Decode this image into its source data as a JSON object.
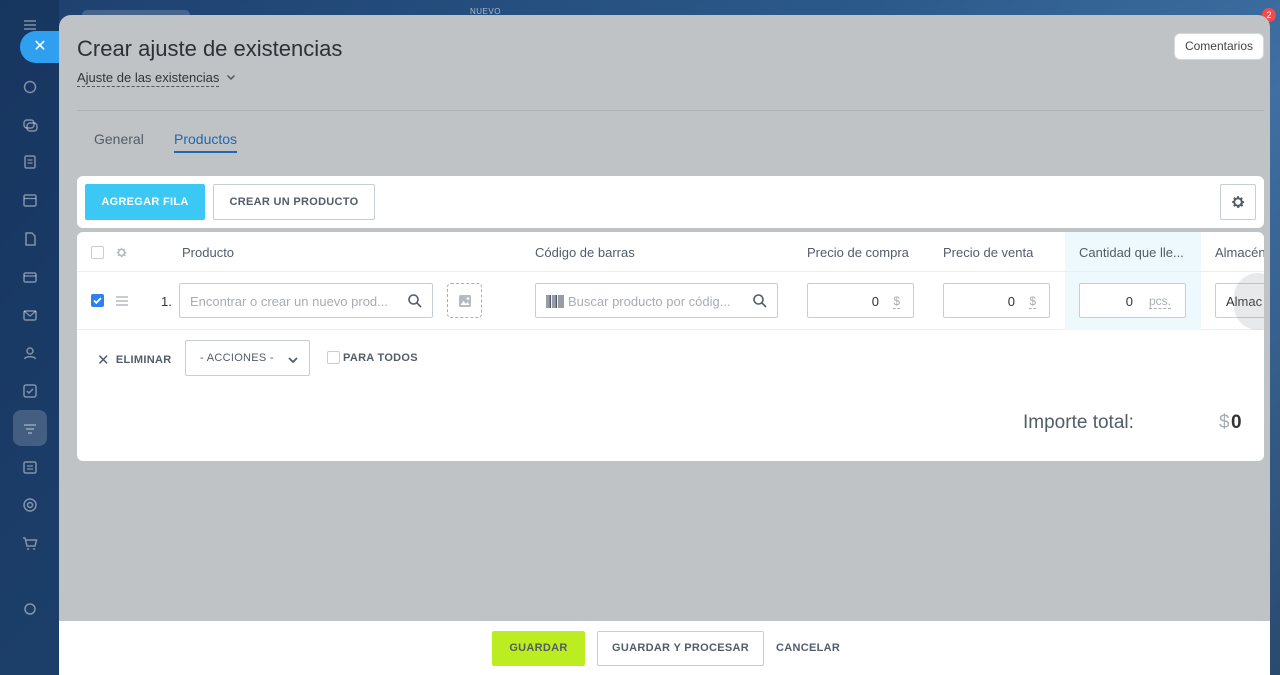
{
  "background": {
    "top_label": "NUEVO",
    "notification_count": "2"
  },
  "slider": {
    "title": "Crear ajuste de existencias",
    "doc_type": "Ajuste de las existencias",
    "comments_label": "Comentarios",
    "tabs": [
      {
        "label": "General",
        "active": false
      },
      {
        "label": "Productos",
        "active": true
      }
    ]
  },
  "toolbar": {
    "add_row_label": "AGREGAR FILA",
    "create_product_label": "CREAR UN PRODUCTO"
  },
  "grid": {
    "columns": [
      "Producto",
      "Código de barras",
      "Precio de compra",
      "Precio de venta",
      "Cantidad que lle...",
      "Almacén"
    ],
    "rows": [
      {
        "index": "1.",
        "checked": true,
        "product_placeholder": "Encontrar o crear un nuevo prod...",
        "barcode_placeholder": "Buscar producto por códig...",
        "purchase_price": "0",
        "purchase_currency": "$",
        "sale_price": "0",
        "sale_currency": "$",
        "quantity": "0",
        "unit": "pcs.",
        "store": "Almac"
      }
    ],
    "actions": {
      "delete_label": "ELIMINAR",
      "actions_select": "- ACCIONES -",
      "for_all_label": "PARA TODOS"
    },
    "total_label": "Importe total:",
    "total_currency": "$",
    "total_value": "0"
  },
  "footer": {
    "save_label": "GUARDAR",
    "save_process_label": "GUARDAR Y PROCESAR",
    "cancel_label": "CANCELAR"
  },
  "colors": {
    "accent_blue": "#3bc8f5",
    "save_green": "#bbed21",
    "tab_active": "#2067b0",
    "checkbox_checked": "#2f7ff0"
  }
}
